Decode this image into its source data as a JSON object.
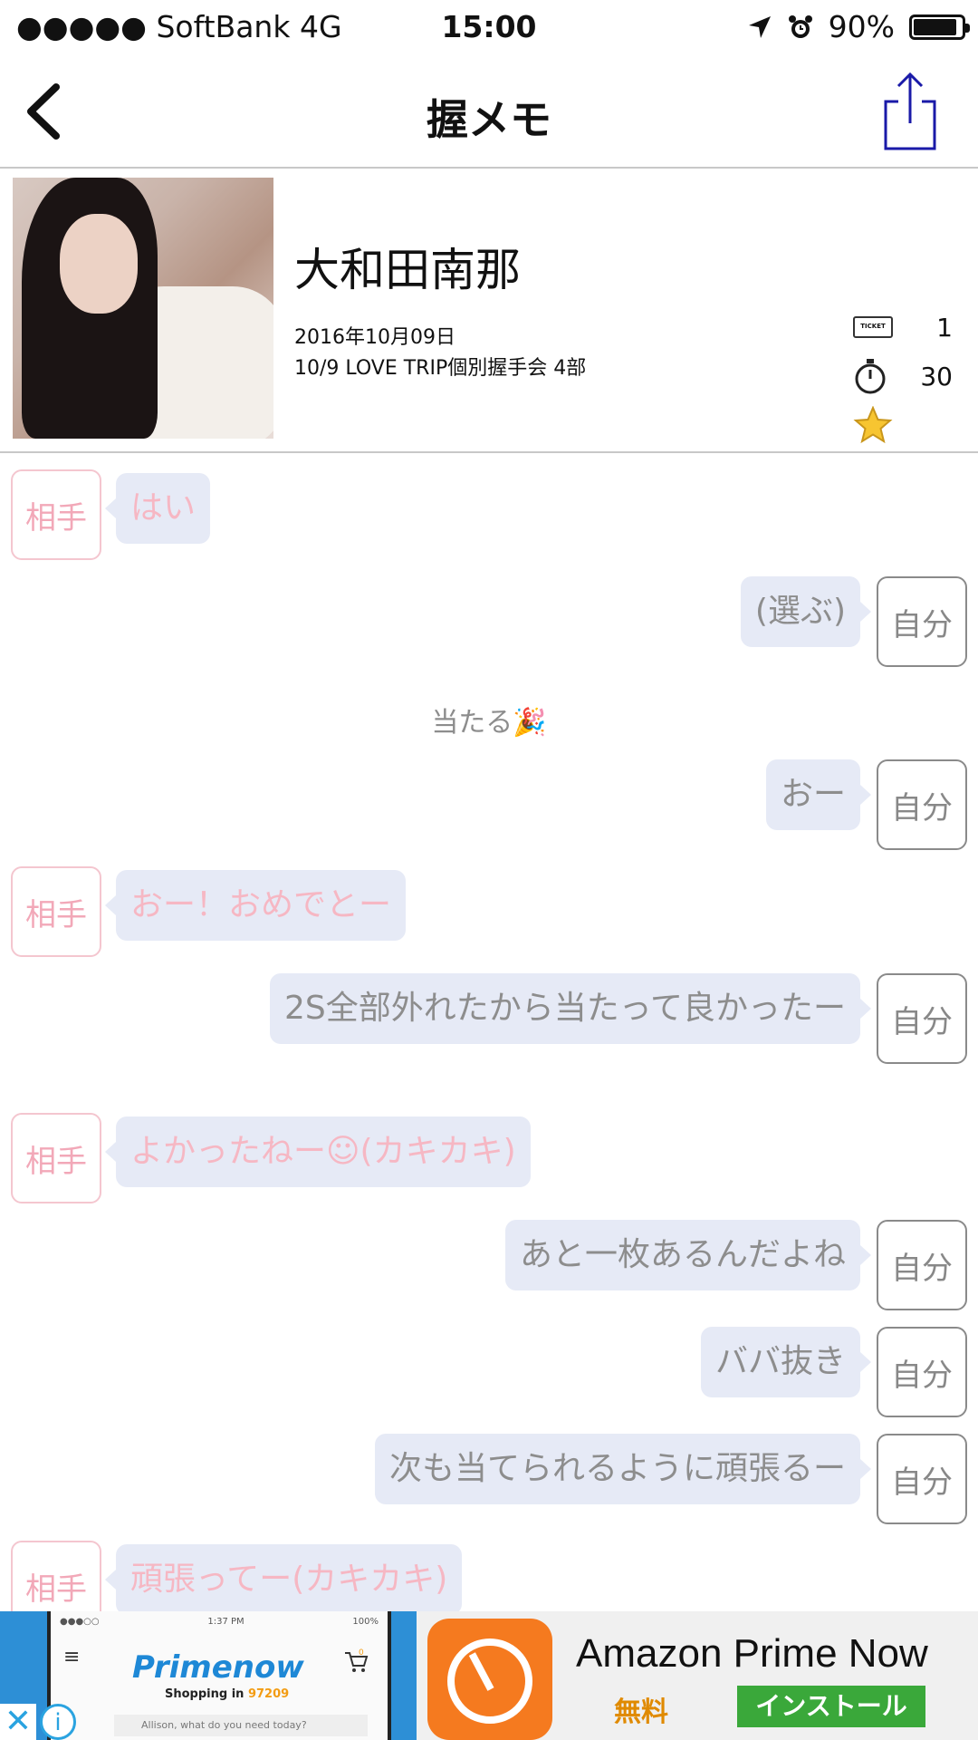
{
  "status_bar": {
    "carrier": "●●●●● SoftBank  4G",
    "time": "15:00",
    "battery": "90%",
    "battery_level": 0.9
  },
  "nav": {
    "title": "握メモ",
    "back_icon": "chevron-left-icon",
    "share_icon": "share-icon"
  },
  "profile": {
    "name": "大和田南那",
    "date": "2016年10月09日",
    "event": "10/9 LOVE TRIP個別握手会 4部",
    "ticket_count": "1",
    "seconds": "30",
    "icons": [
      "ticket-icon",
      "stopwatch-icon",
      "star-icon"
    ]
  },
  "chat": {
    "other_label": "相手",
    "self_label": "自分",
    "messages": [
      {
        "from": "other",
        "text": "はい"
      },
      {
        "from": "self",
        "text": "(選ぶ)"
      },
      {
        "from": "center",
        "text": "当たる🎉"
      },
      {
        "from": "self",
        "text": "おー"
      },
      {
        "from": "other",
        "text": "おー！おめでとー"
      },
      {
        "from": "self",
        "text": "2S全部外れたから当たって良かったー"
      },
      {
        "from": "other",
        "text": "よかったねー☺(カキカキ)"
      },
      {
        "from": "self",
        "text": "あと一枚あるんだよね"
      },
      {
        "from": "self",
        "text": "ババ抜き"
      },
      {
        "from": "self",
        "text": "次も当てられるように頑張るー"
      },
      {
        "from": "other",
        "text": "頑張ってー(カキカキ)"
      }
    ]
  },
  "ad": {
    "screenshot": {
      "time": "1:37 PM",
      "battery": "100%",
      "brand": "Primenow",
      "shipping_prefix": "Shopping in",
      "zip": "97209",
      "search_placeholder": "Allison, what do you need today?",
      "cart_count": "0"
    },
    "title": "Amazon Prime Now",
    "price": "無料",
    "install": "インストール",
    "brand_color": "#f57a1f"
  }
}
